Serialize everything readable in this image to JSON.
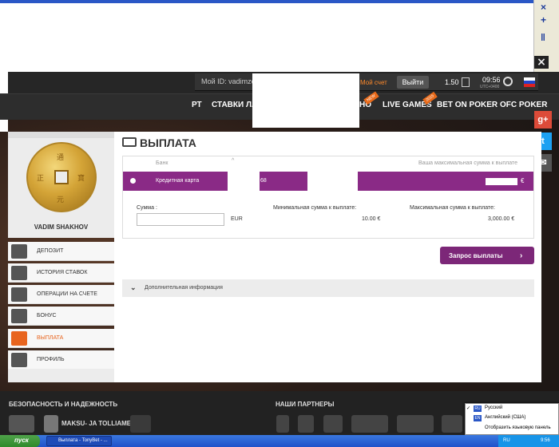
{
  "header": {
    "account_id": "Мой ID: vadimzes",
    "my_account": "Мой счет",
    "logout": "Выйти",
    "balance": "1.50",
    "time": "09:56",
    "timezone": "UTC+0400",
    "nav": [
      "РТ",
      "СТАВКИ ЛА",
      "НО",
      "LIVE GAMES",
      "BET ON POKER",
      "OFC POKER"
    ],
    "badges": [
      "NEW",
      "2015"
    ]
  },
  "social": [
    "g+",
    "t",
    "✉"
  ],
  "profile": {
    "username": "VADIM SHAKHOV",
    "coin_chars": [
      "通",
      "寶",
      "元",
      "正"
    ]
  },
  "menu": [
    {
      "label": "ДЕПОЗИТ",
      "icon": "wallet-icon"
    },
    {
      "label": "ИСТОРИЯ СТАВОК",
      "icon": "list-icon"
    },
    {
      "label": "ОПЕРАЦИИ НА СЧЕТЕ",
      "icon": "coins-icon"
    },
    {
      "label": "БОНУС",
      "icon": "gift-icon"
    },
    {
      "label": "ВЫПЛАТА",
      "icon": "money-icon"
    },
    {
      "label": "ПРОФИЛЬ",
      "icon": "sliders-icon"
    }
  ],
  "main": {
    "title": "ВЫПЛАТА",
    "col_bank": "Банк",
    "col_max": "Ваша максимальная сумма к выплате",
    "card_name": "Кредитная карта",
    "card_digits": "68",
    "card_euro": "€",
    "sum_label": "Сумма :",
    "sum_value": "",
    "sum_currency": "EUR",
    "min_label": "Минимальная сумма к выплате:",
    "min_value": "10.00 €",
    "max_label": "Максимальная сумма к выплате:",
    "max_value": "3,000.00 €",
    "request_button": "Запрос выплаты",
    "extra_info": "Дополнительная информация"
  },
  "footer": {
    "security_title": "БЕЗОПАСНОСТЬ И НАДЕЖНОСТЬ",
    "partners_title": "НАШИ ПАРТНЕРЫ",
    "maksu_text": "MAKSU- JA TOLLIAMET"
  },
  "lang_popup": {
    "items": [
      {
        "code": "RU",
        "label": "Русский",
        "checked": true
      },
      {
        "code": "EN",
        "label": "Английский (США)",
        "checked": false
      }
    ],
    "show_bar": "Отобразить языковую панель"
  },
  "taskbar": {
    "start": "пуск",
    "task": "Выплата - TonyBet - ...",
    "tray_lang": "RU",
    "tray_time": "9:56"
  },
  "colors": {
    "accent_purple": "#8a2a86",
    "accent_orange": "#e8641e"
  }
}
